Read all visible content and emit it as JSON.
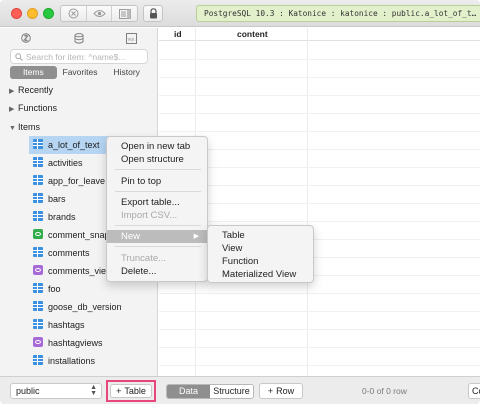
{
  "connection": {
    "label": "PostgreSQL 10.3 : Katonice : katonice : public.a_lot_of_t…"
  },
  "sidebar": {
    "icons": [
      "sidebar-items-icon",
      "database-icon",
      "sql-icon"
    ],
    "search_placeholder": "Search for item: ^name$...",
    "tabs": [
      {
        "label": "Items",
        "active": true
      },
      {
        "label": "Favorites",
        "active": false
      },
      {
        "label": "History",
        "active": false
      }
    ],
    "sections": {
      "recently": "Recently",
      "functions": "Functions",
      "items": "Items"
    },
    "items": [
      {
        "label": "a_lot_of_text",
        "type": "table",
        "selected": true
      },
      {
        "label": "activities",
        "type": "table"
      },
      {
        "label": "app_for_leave",
        "type": "table"
      },
      {
        "label": "bars",
        "type": "table"
      },
      {
        "label": "brands",
        "type": "table"
      },
      {
        "label": "comment_snap",
        "type": "view"
      },
      {
        "label": "comments",
        "type": "table"
      },
      {
        "label": "comments_view",
        "type": "materialized-view"
      },
      {
        "label": "foo",
        "type": "table"
      },
      {
        "label": "goose_db_version",
        "type": "table"
      },
      {
        "label": "hashtags",
        "type": "table"
      },
      {
        "label": "hashtagviews",
        "type": "materialized-view"
      },
      {
        "label": "installations",
        "type": "table"
      }
    ]
  },
  "grid": {
    "columns": [
      "id",
      "content"
    ]
  },
  "context_menu": {
    "items": [
      {
        "label": "Open in new tab",
        "disabled": false
      },
      {
        "label": "Open structure",
        "disabled": false
      },
      {
        "label": "Pin to top",
        "disabled": false
      },
      {
        "label": "Export table...",
        "disabled": false
      },
      {
        "label": "Import CSV...",
        "disabled": true
      },
      {
        "label": "New",
        "disabled": false,
        "submenu": true
      },
      {
        "label": "Truncate...",
        "disabled": true
      },
      {
        "label": "Delete...",
        "disabled": false
      }
    ],
    "submenu_arrow": "▶"
  },
  "new_submenu": {
    "items": [
      "Table",
      "View",
      "Function",
      "Materialized View"
    ]
  },
  "bottombar": {
    "schema": "public",
    "add_table_label": "Table",
    "tabs": [
      {
        "label": "Data",
        "active": true
      },
      {
        "label": "Structure",
        "active": false
      }
    ],
    "add_row_label": "Row",
    "row_count": "0-0 of 0 row",
    "right_button": "Co"
  },
  "colors": {
    "selection": "#b5d5f3",
    "highlight_border": "#e8457a",
    "connection_bar": "#e2f0cb",
    "table_icon": "#3a8fe0",
    "view_icon": "#2fae49",
    "materialized_view_icon": "#a86ad8"
  }
}
